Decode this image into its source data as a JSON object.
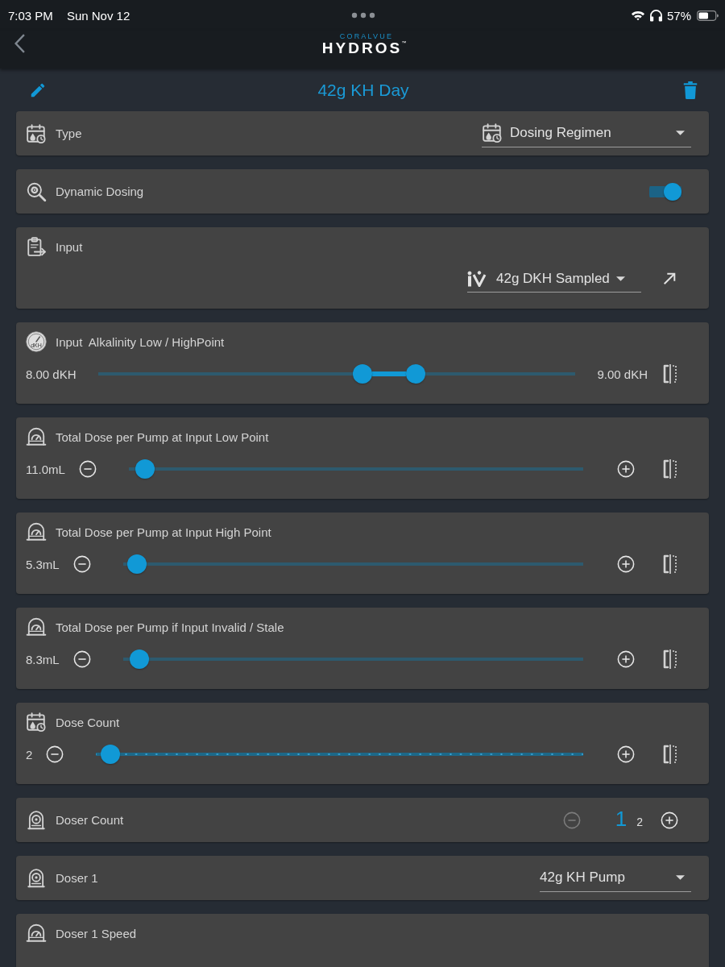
{
  "status_bar": {
    "time": "7:03 PM",
    "date": "Sun Nov 12",
    "battery": "57%"
  },
  "header": {
    "brand_small": "CORALVUE",
    "brand": "HYDROS",
    "trademark": "™"
  },
  "title_bar": {
    "title": "42g KH Day"
  },
  "settings": [
    {
      "kind": "type_select",
      "label": "Type",
      "value": "Dosing Regimen"
    },
    {
      "kind": "toggle",
      "label": "Dynamic Dosing",
      "on": true
    },
    {
      "kind": "input",
      "label": "Input",
      "value": "42g DKH Sampled"
    },
    {
      "kind": "range",
      "label": "Input  Alkalinity Low / HighPoint",
      "icon_text": "dKH",
      "low": "8.00 dKH",
      "high": "9.00 dKH",
      "thumbs": [
        {
          "level": 0.557
        },
        {
          "level": 0.672
        }
      ]
    },
    {
      "kind": "dose_slider",
      "label": "Total Dose per Pump at Input Low Point",
      "reading": "11.0mL",
      "level": 0.015
    },
    {
      "kind": "dose_slider",
      "label": "Total Dose per Pump at Input High Point",
      "reading": "5.3mL",
      "level": 0.01
    },
    {
      "kind": "dose_slider",
      "label": "Total Dose per Pump if Input Invalid / Stale",
      "reading": "8.3mL",
      "level": 0.015
    },
    {
      "kind": "count_slider",
      "label": "Dose Count",
      "reading": "2",
      "level": 0.01
    },
    {
      "kind": "stepper",
      "label": "Doser Count",
      "decrement_disabled": true,
      "increment_disabled": false,
      "options": [
        {
          "label": "1",
          "selected": true
        },
        {
          "label": "2",
          "selected": false
        }
      ]
    },
    {
      "kind": "doser_select",
      "label": "Doser 1",
      "value": "42g KH Pump"
    },
    {
      "kind": "dose_slider",
      "label": "Doser 1 Speed"
    }
  ]
}
